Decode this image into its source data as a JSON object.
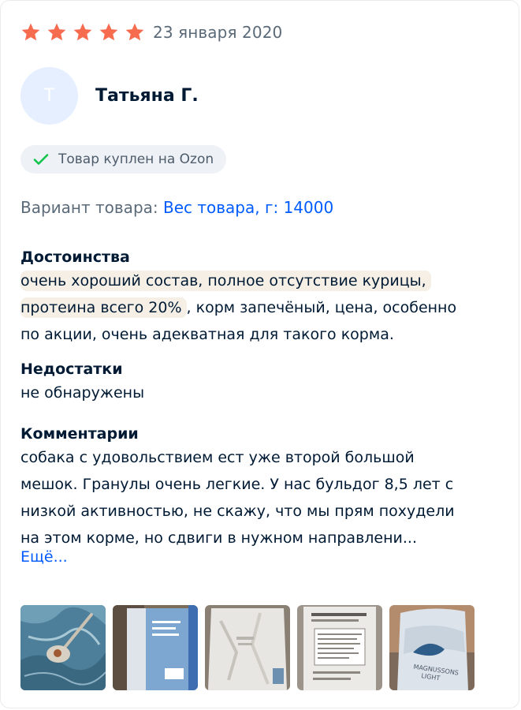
{
  "review": {
    "rating": 5,
    "date": "23 января 2020",
    "author": {
      "initial": "Т",
      "name": "Татьяна Г."
    },
    "badge": "Товар куплен на Ozon",
    "variant": {
      "label": "Вариант товара:",
      "value": "Вес товара, г: 14000"
    },
    "pros": {
      "title": "Достоинства",
      "highlight_1": "очень хороший состав, полное отсутствие курицы,",
      "highlight_2": "протеина всего 20%",
      "rest": ", корм запечёный, цена, особенно",
      "line_3": "по акции, очень адекватная для такого корма."
    },
    "cons": {
      "title": "Недостатки",
      "text": "не обнаружены"
    },
    "comment": {
      "title": "Комментарии",
      "lines": [
        "собака с удовольствием ест уже второй большой",
        "мешок. Гранулы очень легкие. У нас бульдог 8,5 лет с",
        "низкой активностью, не скажу, что мы прям похудели",
        "на этом корме, но сдвиги в нужном направлени..."
      ],
      "more": "Ещё..."
    },
    "photos": [
      "photo-spoon-kibble",
      "photo-bag-back",
      "photo-bag-white",
      "photo-bag-label",
      "photo-bag-magnussons"
    ]
  },
  "colors": {
    "star": "#f76b4f",
    "check": "#10c44c",
    "link": "#005bff",
    "text": "#001a34",
    "muted": "#5b6a79"
  }
}
